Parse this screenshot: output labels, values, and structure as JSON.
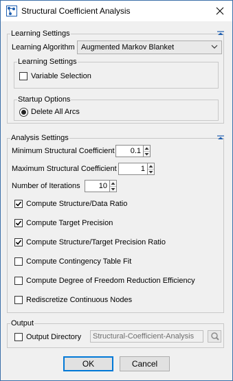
{
  "window": {
    "title": "Structural Coefficient Analysis"
  },
  "learning": {
    "legend": "Learning Settings",
    "algorithm_label": "Learning Algorithm",
    "algorithm_value": "Augmented Markov Blanket",
    "inner": {
      "legend": "Learning Settings",
      "variable_selection": "Variable Selection",
      "variable_selection_checked": false
    },
    "startup": {
      "legend": "Startup Options",
      "delete_all_arcs": "Delete All Arcs",
      "delete_all_arcs_selected": true
    }
  },
  "analysis": {
    "legend": "Analysis Settings",
    "min_label": "Minimum Structural Coefficient",
    "min_value": "0.1",
    "max_label": "Maximum Structural Coefficient",
    "max_value": "1",
    "iter_label": "Number of Iterations",
    "iter_value": "10",
    "options": [
      {
        "label": "Compute Structure/Data Ratio",
        "checked": true
      },
      {
        "label": "Compute Target Precision",
        "checked": true
      },
      {
        "label": "Compute Structure/Target Precision Ratio",
        "checked": true
      },
      {
        "label": "Compute Contingency Table Fit",
        "checked": false
      },
      {
        "label": "Compute Degree of Freedom Reduction Efficiency",
        "checked": false
      },
      {
        "label": "Rediscretize Continuous Nodes",
        "checked": false
      }
    ]
  },
  "output": {
    "legend": "Output",
    "directory_label": "Output Directory",
    "directory_checked": false,
    "directory_value": "Structural-Coefficient-Analysis"
  },
  "buttons": {
    "ok": "OK",
    "cancel": "Cancel"
  },
  "colors": {
    "accent": "#0078d7",
    "check_mark": "#000000"
  }
}
